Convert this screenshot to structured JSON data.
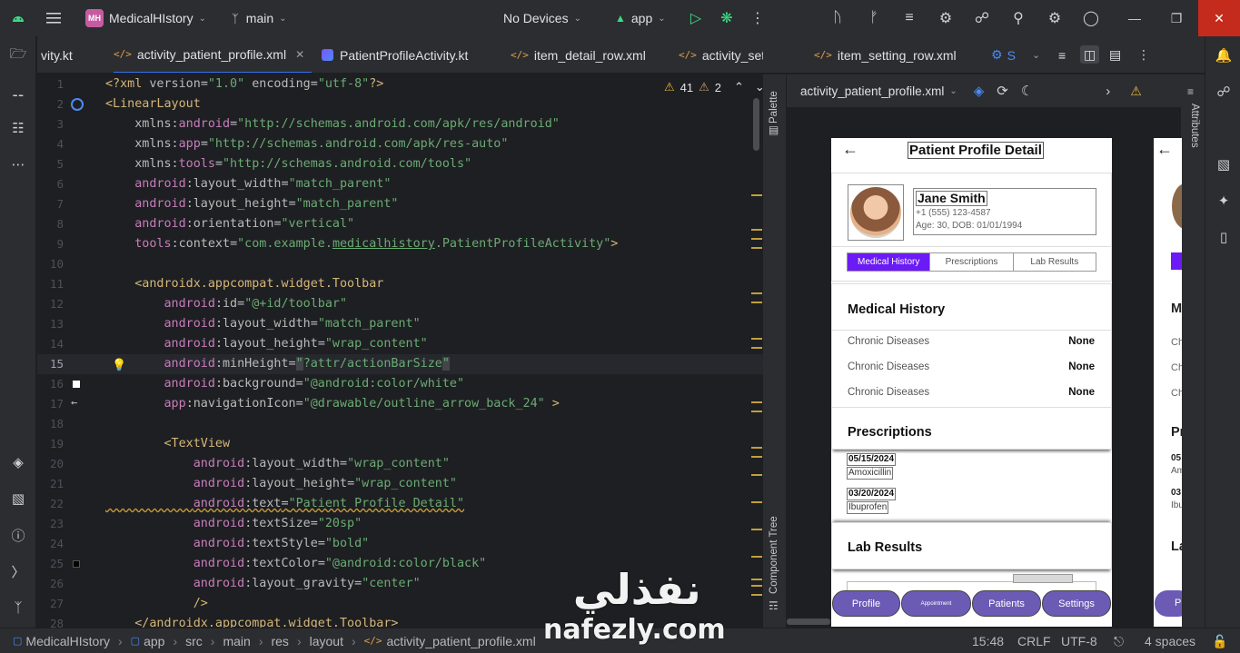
{
  "titlebar": {
    "project_badge": "MH",
    "project_name": "MedicalHIstory",
    "branch": "main",
    "devices": "No Devices",
    "run_config": "app"
  },
  "tabs": [
    {
      "label": "vity.kt",
      "kind": "kotlin"
    },
    {
      "label": "activity_patient_profile.xml",
      "kind": "xml",
      "active": true
    },
    {
      "label": "PatientProfileActivity.kt",
      "kind": "kotlin"
    },
    {
      "label": "item_detail_row.xml",
      "kind": "xml"
    },
    {
      "label": "activity_settings.xml",
      "kind": "xml"
    },
    {
      "label": "item_setting_row.xml",
      "kind": "xml"
    },
    {
      "label": "S",
      "kind": "other"
    }
  ],
  "inspections": {
    "warnings": "41",
    "weak_warnings": "2"
  },
  "editor": {
    "current_line": 15,
    "lines": [
      {
        "n": "1",
        "t": "<?xml version=\"1.0\" encoding=\"utf-8\"?>"
      },
      {
        "n": "2",
        "t": "<LinearLayout"
      },
      {
        "n": "3",
        "t": "    xmlns:android=\"http://schemas.android.com/apk/res/android\""
      },
      {
        "n": "4",
        "t": "    xmlns:app=\"http://schemas.android.com/apk/res-auto\""
      },
      {
        "n": "5",
        "t": "    xmlns:tools=\"http://schemas.android.com/tools\""
      },
      {
        "n": "6",
        "t": "    android:layout_width=\"match_parent\""
      },
      {
        "n": "7",
        "t": "    android:layout_height=\"match_parent\""
      },
      {
        "n": "8",
        "t": "    android:orientation=\"vertical\""
      },
      {
        "n": "9",
        "t": "    tools:context=\"com.example.medicalhistory.PatientProfileActivity\">"
      },
      {
        "n": "10",
        "t": ""
      },
      {
        "n": "11",
        "t": "    <androidx.appcompat.widget.Toolbar"
      },
      {
        "n": "12",
        "t": "        android:id=\"@+id/toolbar\""
      },
      {
        "n": "13",
        "t": "        android:layout_width=\"match_parent\""
      },
      {
        "n": "14",
        "t": "        android:layout_height=\"wrap_content\""
      },
      {
        "n": "15",
        "t": "        android:minHeight=\"?attr/actionBarSize\""
      },
      {
        "n": "16",
        "t": "        android:background=\"@android:color/white\""
      },
      {
        "n": "17",
        "t": "        app:navigationIcon=\"@drawable/outline_arrow_back_24\" >"
      },
      {
        "n": "18",
        "t": ""
      },
      {
        "n": "19",
        "t": "        <TextView"
      },
      {
        "n": "20",
        "t": "            android:layout_width=\"wrap_content\""
      },
      {
        "n": "21",
        "t": "            android:layout_height=\"wrap_content\""
      },
      {
        "n": "22",
        "t": "            android:text=\"Patient Profile Detail\""
      },
      {
        "n": "23",
        "t": "            android:textSize=\"20sp\""
      },
      {
        "n": "24",
        "t": "            android:textStyle=\"bold\""
      },
      {
        "n": "25",
        "t": "            android:textColor=\"@android:color/black\""
      },
      {
        "n": "26",
        "t": "            android:layout_gravity=\"center\""
      },
      {
        "n": "27",
        "t": "            />"
      },
      {
        "n": "28",
        "t": "    </androidx.appcompat.widget.Toolbar>"
      }
    ]
  },
  "design": {
    "file": "activity_patient_profile.xml",
    "palette_label": "Palette",
    "component_tree_label": "Component Tree",
    "attributes_label": "Attributes"
  },
  "preview": {
    "toolbar_title": "Patient Profile Detail",
    "patient": {
      "name": "Jane Smith",
      "phone": "+1 (555) 123-4587",
      "age_dob": "Age: 30, DOB: 01/01/1994"
    },
    "tabs": [
      "Medical History",
      "Prescriptions",
      "Lab Results"
    ],
    "medical_history_title": "Medical History",
    "history_rows": [
      {
        "label": "Chronic Diseases",
        "value": "None"
      },
      {
        "label": "Chronic Diseases",
        "value": "None"
      },
      {
        "label": "Chronic Diseases",
        "value": "None"
      }
    ],
    "prescriptions_title": "Prescriptions",
    "prescriptions": [
      {
        "date": "05/15/2024",
        "med": "Amoxicillin"
      },
      {
        "date": "03/20/2024",
        "med": "Ibuprofen"
      }
    ],
    "lab_results_title": "Lab Results",
    "bottom_nav": [
      "Profile",
      "Appointment",
      "Patients",
      "Settings"
    ],
    "second_preview": {
      "m": "M",
      "ch1": "Ch",
      "ch2": "Ch",
      "ch3": "Ch",
      "pr": "Pr",
      "d1": "05",
      "m1": "Am",
      "d2": "03",
      "m2": "Ibu",
      "la": "La",
      "nav": "P"
    }
  },
  "statusbar": {
    "breadcrumb": [
      "MedicalHIstory",
      "app",
      "src",
      "main",
      "res",
      "layout",
      "activity_patient_profile.xml"
    ],
    "position": "15:48",
    "line_sep": "CRLF",
    "encoding": "UTF-8",
    "indent": "4 spaces"
  },
  "watermark": {
    "arabic": "نفذلي",
    "latin": "nafezly.com"
  },
  "colors": {
    "accent": "#3574f0",
    "tab_selected": "#6b1bf5",
    "close": "#c42b1c"
  }
}
